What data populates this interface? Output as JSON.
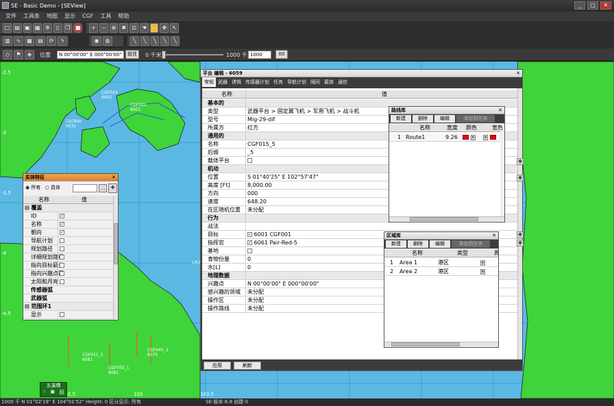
{
  "window": {
    "title": "SE - Basic Demo - [SEView]",
    "min": "_",
    "max": "□",
    "close": "✕"
  },
  "menu": [
    "文件",
    "工具条",
    "地图",
    "显示",
    "CGF",
    "工具",
    "帮助"
  ],
  "posbar": {
    "pos_label": "位置",
    "pos_value": "N 00°00'00\" E 000°00'00\"",
    "goto_btn": "前往",
    "range_min": "0 千米",
    "range_max": "1000 千米",
    "zoom_value": "1000",
    "zoom_btn": "00"
  },
  "map": {
    "lat_labels": [
      "-2.5",
      "-3",
      "-3.5",
      "-4",
      "-4.5",
      "-5",
      "-5.5",
      "-6",
      "-6.5",
      "-7"
    ],
    "lon_labels": [
      "102.5",
      "103",
      "103.5",
      "104",
      "104.5",
      "105",
      "105.5"
    ],
    "units": [
      {
        "name": "CGF024",
        "id": "6002"
      },
      {
        "name": "GLORIA",
        "id": "6031"
      },
      {
        "name": "CGF001",
        "id": "6001"
      },
      {
        "name": "CGF051_5",
        "id": "6081"
      },
      {
        "name": "CGF045_2",
        "id": "6075"
      },
      {
        "name": "CGF055_1",
        "id": "6081"
      },
      {
        "name": "LAU",
        "id": ""
      }
    ],
    "compass_label": "五溪佛",
    "compass_buttons": [
      "☝",
      "▣",
      "回"
    ]
  },
  "entity_panel": {
    "title": "实体特征",
    "radio_all": "所有",
    "radio_specific": "具体",
    "col_name": "名称",
    "col_value": "值",
    "rows": [
      {
        "label": "覆盖",
        "type": "cat"
      },
      {
        "label": "ID",
        "checked": true
      },
      {
        "label": "名称",
        "checked": true
      },
      {
        "label": "朝向",
        "checked": true
      },
      {
        "label": "导航计划",
        "checked": false
      },
      {
        "label": "规划路径",
        "checked": false
      },
      {
        "label": "详细规划路径",
        "checked": false
      },
      {
        "label": "指向目标箭头",
        "checked": false
      },
      {
        "label": "指向兴趣点箭",
        "checked": false
      },
      {
        "label": "太阳和月亮",
        "checked": false
      },
      {
        "label": "传感器弧",
        "type": "bold"
      },
      {
        "label": "武器弧",
        "type": "bold"
      },
      {
        "label": "范围环1",
        "type": "cat"
      },
      {
        "label": "显示",
        "checked": false
      }
    ]
  },
  "platform_panel": {
    "title": "平台 编辑 - 6059",
    "tabs": [
      "常规",
      "武器",
      "诱饵",
      "传感器计划",
      "任务",
      "导航计划",
      "隔间",
      "载体",
      "通信"
    ],
    "col_name": "名称",
    "col_value": "值",
    "rows": [
      {
        "k": "基本的",
        "type": "cat"
      },
      {
        "k": "类型",
        "v": "武器平台 > 固定翼飞机 > 军用飞机 > 战斗机"
      },
      {
        "k": "型号",
        "v": "Mig-29-dif"
      },
      {
        "k": "所属方",
        "v": "红方"
      },
      {
        "k": "通用的",
        "type": "cat"
      },
      {
        "k": "名称",
        "v": "CGF015_5"
      },
      {
        "k": "后缀",
        "v": "_5"
      },
      {
        "k": "载体平台",
        "v": "",
        "check": false
      },
      {
        "k": "机动",
        "type": "cat"
      },
      {
        "k": "位置",
        "v": "S 01°40'25\" E 102°57'47\""
      },
      {
        "k": "高度 [Ft]",
        "v": "8,000.00"
      },
      {
        "k": "方向",
        "v": "000"
      },
      {
        "k": "速度",
        "v": "648.20"
      },
      {
        "k": "在区随机位置",
        "v": "未分配"
      },
      {
        "k": "行为",
        "type": "cat"
      },
      {
        "k": "战法",
        "v": ""
      },
      {
        "k": "目标",
        "v": "6001 CGF001",
        "check": true
      },
      {
        "k": "指挥官",
        "v": "6061 Pair-Red-5",
        "check": true
      },
      {
        "k": "基地",
        "v": "",
        "check": false
      },
      {
        "k": "食物份量",
        "v": "0"
      },
      {
        "k": "水[L]",
        "v": "0"
      },
      {
        "k": "地理数据",
        "type": "cat"
      },
      {
        "k": "兴趣点",
        "v": "N 00°00'00\" E 000°00'00\""
      },
      {
        "k": "感兴趣的领域",
        "v": "未分配"
      },
      {
        "k": "操作区",
        "v": "未分配"
      },
      {
        "k": "操作路线",
        "v": "未分配"
      }
    ],
    "apply_btn": "应用",
    "refresh_btn": "刷新"
  },
  "route_panel": {
    "title": "路线库",
    "btn_new": "新建",
    "btn_delete": "删除",
    "btn_edit": "编辑",
    "btn_add_task": "添加到任务",
    "cols": [
      "名称",
      "宽度",
      "颜色",
      "宽色"
    ],
    "rows": [
      {
        "idx": "1",
        "name": "Route1",
        "width": "9.26"
      }
    ],
    "color": "#e00000"
  },
  "area_panel": {
    "title": "区域库",
    "btn_new": "新建",
    "btn_delete": "删除",
    "btn_edit": "编辑",
    "btn_add_task": "添加到任务",
    "cols": [
      "名称",
      "类型",
      "周"
    ],
    "rows": [
      {
        "idx": "1",
        "name": "Area 1",
        "type": "港区"
      },
      {
        "idx": "2",
        "name": "Area 2",
        "type": "港区"
      }
    ]
  },
  "status": {
    "left": "1000 千 N 01°02'19\" E 104°01'52\" Height: 0 区分显示: 所有",
    "version": "SE-版本-6.8 创建-0"
  },
  "colors": {
    "sea": "#5ab8e3",
    "land": "#3fd43a",
    "panel": "#f0f0f0"
  }
}
